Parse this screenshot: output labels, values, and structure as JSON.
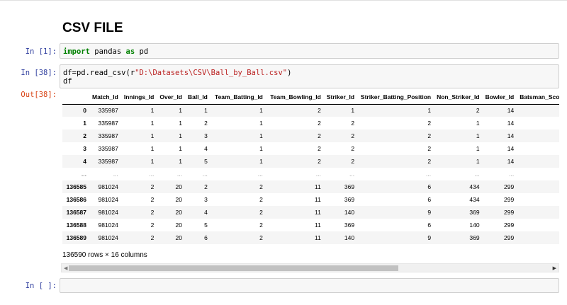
{
  "markdown_title": "CSV FILE",
  "cells": [
    {
      "prompt": "In [1]:",
      "code": {
        "kw1": "import",
        "mid": " pandas ",
        "kw2": "as",
        "tail": " pd"
      }
    },
    {
      "prompt": "In [38]:",
      "code": {
        "line1_pre": "df=pd.read_csv(r",
        "line1_str": "\"D:\\Datasets\\CSV\\Ball_by_Ball.csv\"",
        "line1_post": ")",
        "line2": "df"
      }
    },
    {
      "prompt": "In [ ]:"
    }
  ],
  "output_prompt": "Out[38]:",
  "table": {
    "columns": [
      "",
      "Match_Id",
      "Innings_Id",
      "Over_Id",
      "Ball_Id",
      "Team_Batting_Id",
      "Team_Bowling_Id",
      "Striker_Id",
      "Striker_Batting_Position",
      "Non_Striker_Id",
      "Bowler_Id",
      "Batsman_Scor"
    ],
    "rows": [
      [
        "0",
        "335987",
        "1",
        "1",
        "1",
        "1",
        "2",
        "1",
        "1",
        "2",
        "14",
        ""
      ],
      [
        "1",
        "335987",
        "1",
        "1",
        "2",
        "1",
        "2",
        "2",
        "2",
        "1",
        "14",
        ""
      ],
      [
        "2",
        "335987",
        "1",
        "1",
        "3",
        "1",
        "2",
        "2",
        "2",
        "1",
        "14",
        ""
      ],
      [
        "3",
        "335987",
        "1",
        "1",
        "4",
        "1",
        "2",
        "2",
        "2",
        "1",
        "14",
        ""
      ],
      [
        "4",
        "335987",
        "1",
        "1",
        "5",
        "1",
        "2",
        "2",
        "2",
        "1",
        "14",
        ""
      ],
      [
        "...",
        "...",
        "...",
        "...",
        "...",
        "...",
        "...",
        "...",
        "...",
        "...",
        "...",
        ""
      ],
      [
        "136585",
        "981024",
        "2",
        "20",
        "2",
        "2",
        "11",
        "369",
        "6",
        "434",
        "299",
        ""
      ],
      [
        "136586",
        "981024",
        "2",
        "20",
        "3",
        "2",
        "11",
        "369",
        "6",
        "434",
        "299",
        ""
      ],
      [
        "136587",
        "981024",
        "2",
        "20",
        "4",
        "2",
        "11",
        "140",
        "9",
        "369",
        "299",
        ""
      ],
      [
        "136588",
        "981024",
        "2",
        "20",
        "5",
        "2",
        "11",
        "369",
        "6",
        "140",
        "299",
        ""
      ],
      [
        "136589",
        "981024",
        "2",
        "20",
        "6",
        "2",
        "11",
        "140",
        "9",
        "369",
        "299",
        ""
      ]
    ]
  },
  "shape_text": "136590 rows × 16 columns",
  "icons": {
    "scroll_left": "triangle-left-icon",
    "scroll_right": "triangle-right-icon"
  },
  "colors": {
    "prompt_in": "#303f9f",
    "prompt_out": "#d84315",
    "keyword": "#008000",
    "string": "#ba2121"
  }
}
